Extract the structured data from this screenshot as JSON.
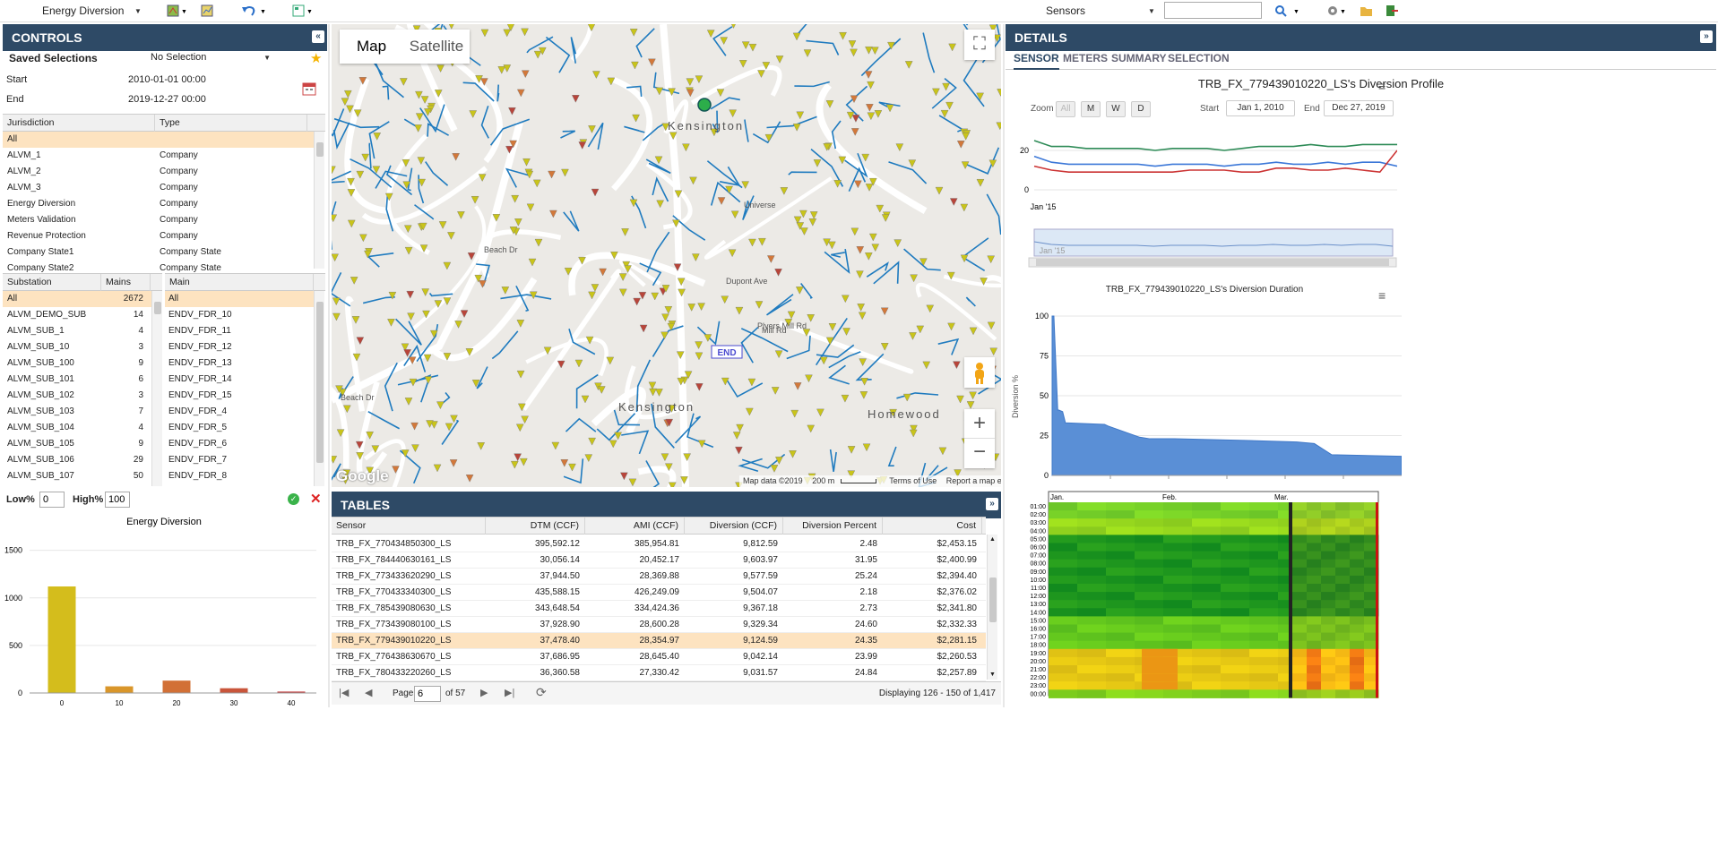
{
  "toolbar": {
    "module": "Energy Diversion",
    "layer": "Sensors",
    "search_value": ""
  },
  "controls": {
    "title": "CONTROLS",
    "saved_label": "Saved Selections",
    "saved_value": "No Selection",
    "start_label": "Start",
    "start_value": "2010-01-01 00:00",
    "end_label": "End",
    "end_value": "2019-12-27 00:00",
    "jur_headers": [
      "Jurisdiction",
      "Type"
    ],
    "jurisdictions": [
      [
        "All",
        ""
      ],
      [
        "ALVM_1",
        "Company"
      ],
      [
        "ALVM_2",
        "Company"
      ],
      [
        "ALVM_3",
        "Company"
      ],
      [
        "Energy Diversion",
        "Company"
      ],
      [
        "Meters Validation",
        "Company"
      ],
      [
        "Revenue Protection",
        "Company"
      ],
      [
        "Company State1",
        "Company State"
      ],
      [
        "Company State2",
        "Company State"
      ]
    ],
    "sub_headers": [
      "Substation",
      "Mains"
    ],
    "substations": [
      [
        "All",
        "2672"
      ],
      [
        "ALVM_DEMO_SUB",
        "14"
      ],
      [
        "ALVM_SUB_1",
        "4"
      ],
      [
        "ALVM_SUB_10",
        "3"
      ],
      [
        "ALVM_SUB_100",
        "9"
      ],
      [
        "ALVM_SUB_101",
        "6"
      ],
      [
        "ALVM_SUB_102",
        "3"
      ],
      [
        "ALVM_SUB_103",
        "7"
      ],
      [
        "ALVM_SUB_104",
        "4"
      ],
      [
        "ALVM_SUB_105",
        "9"
      ],
      [
        "ALVM_SUB_106",
        "29"
      ],
      [
        "ALVM_SUB_107",
        "50"
      ]
    ],
    "main_header": "Main",
    "mains": [
      "All",
      "ENDV_FDR_10",
      "ENDV_FDR_11",
      "ENDV_FDR_12",
      "ENDV_FDR_13",
      "ENDV_FDR_14",
      "ENDV_FDR_15",
      "ENDV_FDR_4",
      "ENDV_FDR_5",
      "ENDV_FDR_6",
      "ENDV_FDR_7",
      "ENDV_FDR_8"
    ],
    "low_label": "Low%",
    "low_value": "0",
    "high_label": "High%",
    "high_value": "100"
  },
  "chart_data": [
    {
      "type": "bar",
      "title": "Energy Diversion",
      "categories": [
        "0",
        "10",
        "20",
        "30",
        "40"
      ],
      "values": [
        1120,
        70,
        130,
        50,
        15
      ],
      "ylim": [
        0,
        1600
      ],
      "yticks": [
        0,
        500,
        1000,
        1500
      ],
      "colors": [
        "#d4bd1c",
        "#d9962a",
        "#d27036",
        "#c9553a",
        "#c63d3d"
      ]
    },
    {
      "type": "line",
      "title": "TRB_FX_779439010220_LS's Diversion Profile",
      "xtick": "Jan '15",
      "yticks": [
        "0",
        "20"
      ],
      "series": [
        {
          "color": "#2e8b57",
          "values": [
            25,
            22,
            22,
            21,
            21,
            21,
            21,
            20,
            21,
            21,
            21,
            20,
            21,
            22,
            22,
            22,
            23,
            22,
            22,
            23,
            23,
            23
          ]
        },
        {
          "color": "#3c78d8",
          "values": [
            17,
            14,
            13,
            13,
            13,
            13,
            13,
            12,
            13,
            13,
            13,
            12,
            13,
            13,
            14,
            13,
            13,
            14,
            13,
            14,
            14,
            12
          ]
        },
        {
          "color": "#cc3333",
          "values": [
            12,
            10,
            9,
            9,
            9,
            9,
            9,
            9,
            9,
            10,
            10,
            10,
            9,
            9,
            11,
            11,
            10,
            10,
            11,
            10,
            9,
            20
          ]
        }
      ]
    },
    {
      "type": "area",
      "title": "TRB_FX_779439010220_LS's Diversion Duration",
      "ylabel": "Diversion %",
      "ylim": [
        0,
        100
      ],
      "yticks": [
        "0",
        "25",
        "50",
        "75",
        "100"
      ],
      "x": [
        0,
        0.5,
        1.6,
        1.9,
        3,
        3.8,
        15,
        16,
        25,
        28,
        34,
        35,
        55,
        70,
        75,
        80,
        100
      ],
      "values": [
        100,
        100,
        41,
        41,
        40,
        33,
        32,
        31,
        24,
        23,
        23,
        23,
        22,
        21,
        20,
        13,
        12
      ]
    }
  ],
  "details": {
    "title": "DETAILS",
    "tabs": [
      "SENSOR",
      "METERS",
      "SUMMARY",
      "SELECTION"
    ],
    "zoom_label": "Zoom",
    "zoom_opts": [
      "All",
      "M",
      "W",
      "D"
    ],
    "start_label": "Start",
    "start_value": "Jan 1, 2010",
    "end_label": "End",
    "end_value": "Dec 27, 2019",
    "nav_tick": "Jan '15",
    "heatmap_months": [
      "Jan.",
      "Feb.",
      "Mar."
    ],
    "heatmap_hours": [
      "01:00",
      "02:00",
      "03:00",
      "04:00",
      "05:00",
      "06:00",
      "07:00",
      "08:00",
      "09:00",
      "10:00",
      "11:00",
      "12:00",
      "13:00",
      "14:00",
      "15:00",
      "16:00",
      "17:00",
      "18:00",
      "19:00",
      "20:00",
      "21:00",
      "22:00",
      "23:00",
      "00:00"
    ]
  },
  "map": {
    "map_tab": "Map",
    "satellite_tab": "Satellite",
    "attribution": "Map data ©2019",
    "scale": "200 m",
    "terms": "Terms of Use",
    "report": "Report a map error",
    "google": "Google",
    "end_marker": "END",
    "labels": [
      "Kensington",
      "Kensington",
      "Homewood",
      "Beach Dr",
      "Beach Dr",
      "Universe",
      "Plyers Mill Rd",
      "Dupont Ave",
      "Mill Rd"
    ]
  },
  "tables": {
    "title": "TABLES",
    "headers": [
      "Sensor",
      "DTM (CCF)",
      "AMI (CCF)",
      "Diversion (CCF)",
      "Diversion Percent",
      "Cost"
    ],
    "rows": [
      [
        "TRB_FX_770434850300_LS",
        "395,592.12",
        "385,954.81",
        "9,812.59",
        "2.48",
        "$2,453.15"
      ],
      [
        "TRB_FX_784440630161_LS",
        "30,056.14",
        "20,452.17",
        "9,603.97",
        "31.95",
        "$2,400.99"
      ],
      [
        "TRB_FX_773433620290_LS",
        "37,944.50",
        "28,369.88",
        "9,577.59",
        "25.24",
        "$2,394.40"
      ],
      [
        "TRB_FX_770433340300_LS",
        "435,588.15",
        "426,249.09",
        "9,504.07",
        "2.18",
        "$2,376.02"
      ],
      [
        "TRB_FX_785439080630_LS",
        "343,648.54",
        "334,424.36",
        "9,367.18",
        "2.73",
        "$2,341.80"
      ],
      [
        "TRB_FX_773439080100_LS",
        "37,928.90",
        "28,600.28",
        "9,329.34",
        "24.60",
        "$2,332.33"
      ],
      [
        "TRB_FX_779439010220_LS",
        "37,478.40",
        "28,354.97",
        "9,124.59",
        "24.35",
        "$2,281.15"
      ],
      [
        "TRB_FX_776438630670_LS",
        "37,686.95",
        "28,645.40",
        "9,042.14",
        "23.99",
        "$2,260.53"
      ],
      [
        "TRB_FX_780433220260_LS",
        "36,360.58",
        "27,330.42",
        "9,031.57",
        "24.84",
        "$2,257.89"
      ]
    ],
    "selected_row": 6,
    "page_label": "Page",
    "page_value": "6",
    "of_label": "of 57",
    "displaying": "Displaying 126 - 150 of 1,417"
  }
}
